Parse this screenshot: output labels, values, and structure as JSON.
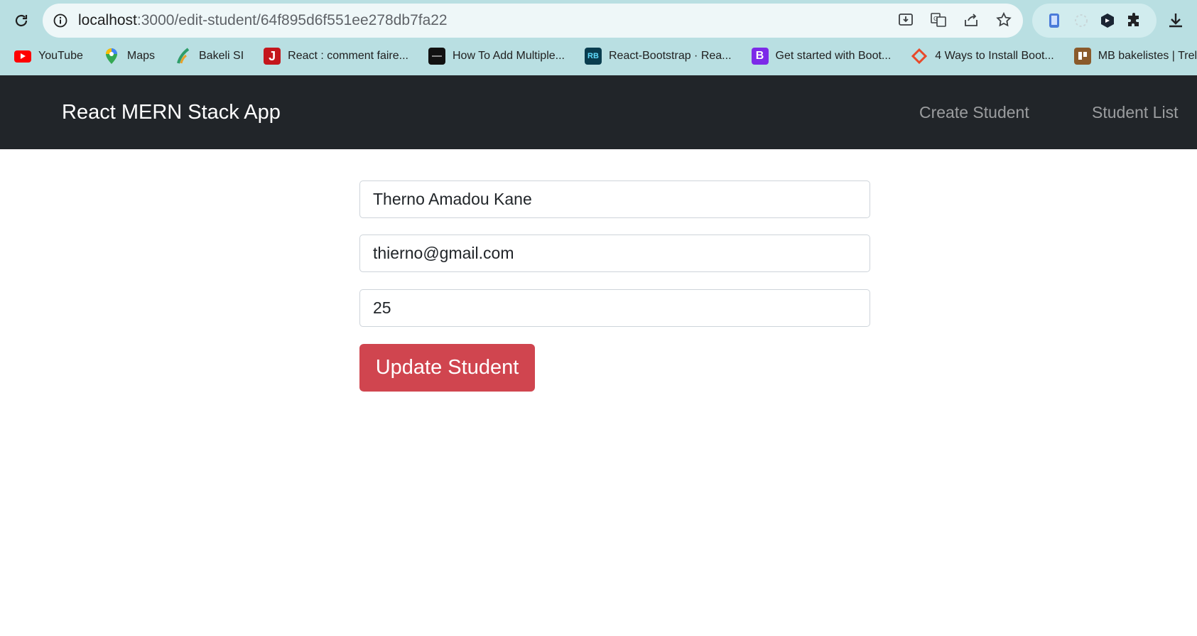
{
  "browser": {
    "url_host": "localhost",
    "url_path": ":3000/edit-student/64f895d6f551ee278db7fa22",
    "bookmarks": [
      {
        "label": "YouTube",
        "icon": "youtube-icon",
        "color": "#ff0000"
      },
      {
        "label": "Maps",
        "icon": "maps-icon",
        "color": "#34a853"
      },
      {
        "label": "Bakeli SI",
        "icon": "bakeli-icon",
        "color": "#2e9e6a"
      },
      {
        "label": "React : comment faire...",
        "icon": "j-icon",
        "color": "#c4161c"
      },
      {
        "label": "How To Add Multiple...",
        "icon": "site-icon",
        "color": "#111111"
      },
      {
        "label": "React-Bootstrap · Rea...",
        "icon": "react-bootstrap-icon",
        "color": "#0a3d4f"
      },
      {
        "label": "Get started with Boot...",
        "icon": "bootstrap-icon",
        "color": "#7c2ae8"
      },
      {
        "label": "4 Ways to Install Boot...",
        "icon": "diamond-icon",
        "color": "#e8492a"
      },
      {
        "label": "MB bakelistes | Trello",
        "icon": "trello-icon",
        "color": "#8a5a2b"
      }
    ]
  },
  "navbar": {
    "brand": "React MERN Stack App",
    "links": [
      "Create Student",
      "Student List"
    ]
  },
  "form": {
    "name": "Therno Amadou Kane",
    "email": "thierno@gmail.com",
    "age": "25",
    "submit_label": "Update Student"
  },
  "colors": {
    "navbar_bg": "#212529",
    "button": "#d0454f",
    "chrome_bg": "#b9dfe2"
  }
}
